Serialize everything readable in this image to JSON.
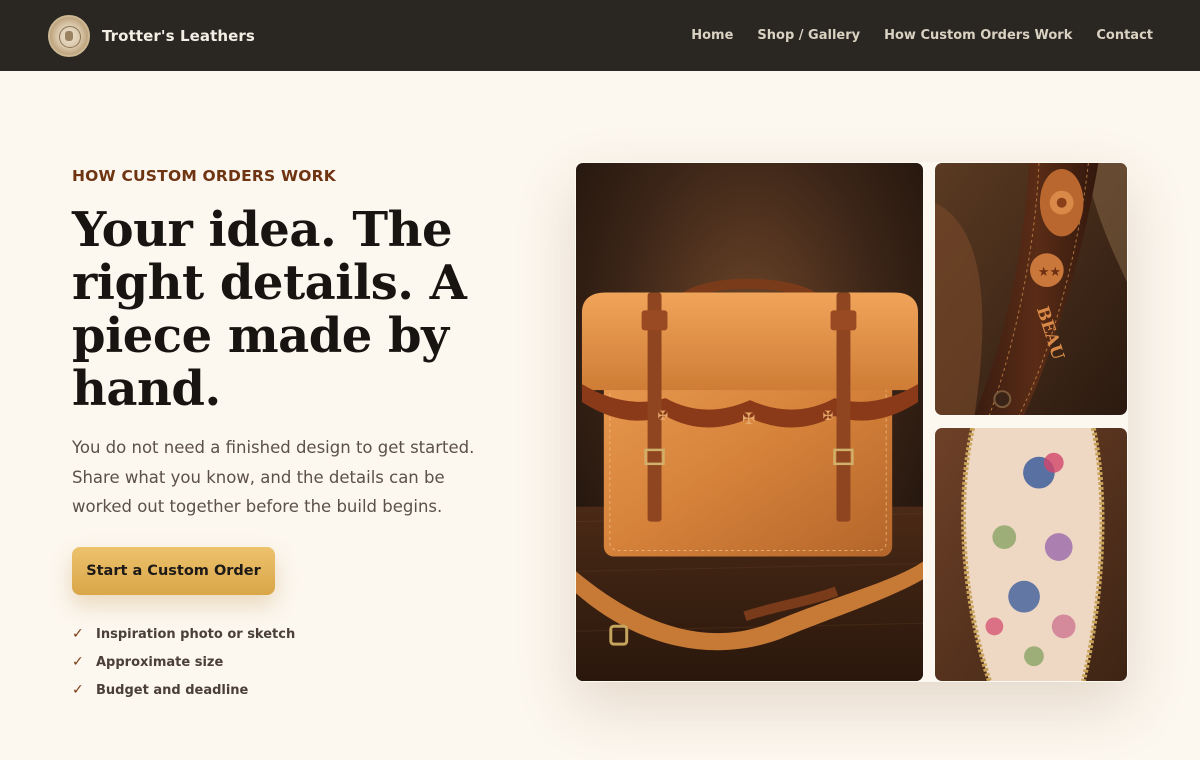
{
  "brand": {
    "name": "Trotter's Leathers",
    "logo_icon": "leather-stamp-seal-icon"
  },
  "nav": {
    "links": [
      {
        "label": "Home"
      },
      {
        "label": "Shop / Gallery"
      },
      {
        "label": "How Custom Orders Work"
      },
      {
        "label": "Contact"
      }
    ]
  },
  "hero": {
    "eyebrow": "HOW CUSTOM ORDERS WORK",
    "headline": "Your idea. The right details. A piece made by hand.",
    "lede": "You do not need a finished design to get started. Share what you know, and the details can be worked out together before the build begins.",
    "cta_label": "Start a Custom Order",
    "checklist": [
      {
        "icon": "check-icon",
        "label": "Inspiration photo or sketch"
      },
      {
        "icon": "check-icon",
        "label": "Approximate size"
      },
      {
        "icon": "check-icon",
        "label": "Budget and deadline"
      }
    ]
  },
  "gallery": {
    "images": [
      {
        "name": "satchel-photo"
      },
      {
        "name": "tooled-strap-photo",
        "strap_text": "BEAU"
      },
      {
        "name": "floral-lining-photo"
      }
    ]
  },
  "colors": {
    "nav_bg": "#2a2722",
    "page_bg": "#fcf7ef",
    "accent_brown": "#6f3412",
    "cta_gold": "#e3b25a"
  }
}
